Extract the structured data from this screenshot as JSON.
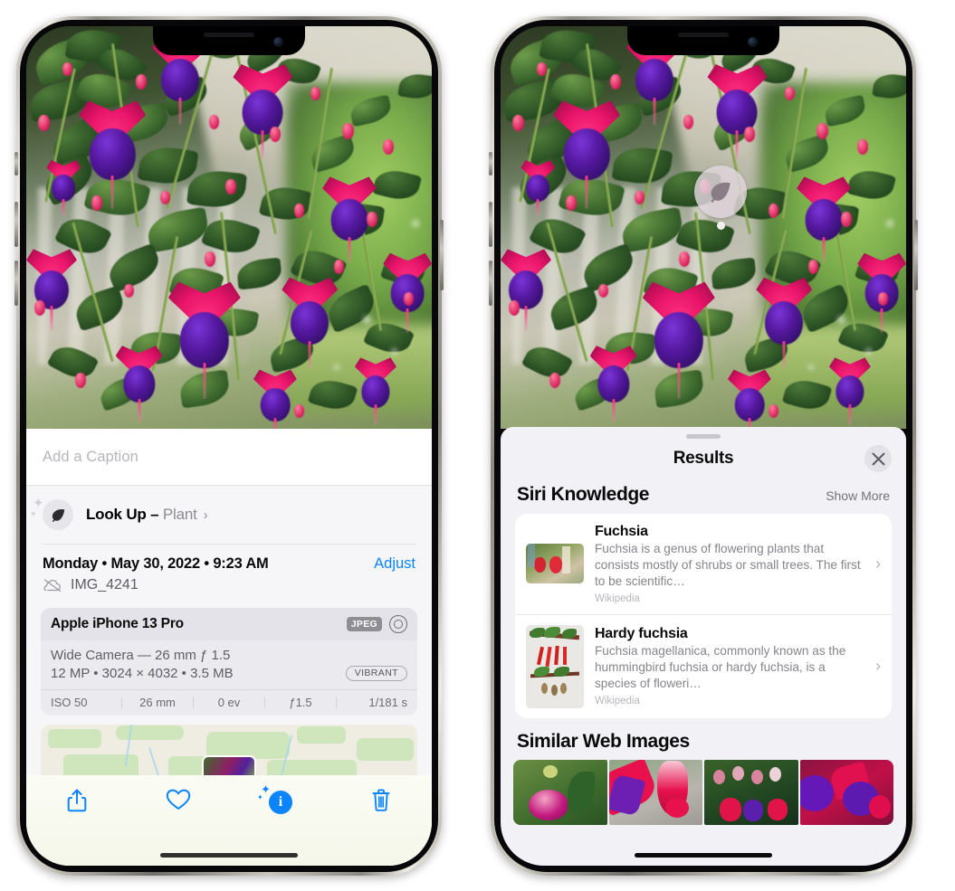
{
  "left_phone": {
    "name": "iphone-photos-info",
    "caption_field": {
      "placeholder": "Add a Caption",
      "value": ""
    },
    "lookup": {
      "icon": "leaf-icon",
      "label": "Look Up – ",
      "subject": "Plant",
      "chevron": "›"
    },
    "metadata": {
      "date_line": "Monday • May 30, 2022 • 9:23 AM",
      "adjust_label": "Adjust",
      "cloud_icon": "cloud-slash-icon",
      "file_name": "IMG_4241"
    },
    "camera_card": {
      "device": "Apple iPhone 13 Pro",
      "format_badge": "JPEG",
      "lens_icon": "lens-icon",
      "lens_line": "Wide Camera — 26 mm ƒ 1.5",
      "specs_line": "12 MP • 3024 × 4032 • 3.5 MB",
      "style_badge": "VIBRANT",
      "exif": [
        "ISO 50",
        "26 mm",
        "0 ev",
        "ƒ1.5",
        "1/181 s"
      ]
    },
    "map": {
      "name": "location-map",
      "pin": "photo-thumbnail-pin"
    },
    "toolbar": [
      {
        "name": "share-button",
        "icon": "share-icon"
      },
      {
        "name": "favorite-button",
        "icon": "heart-icon"
      },
      {
        "name": "visual-lookup-button",
        "icon": "info-sparkle-icon",
        "glyph": "i"
      },
      {
        "name": "delete-button",
        "icon": "trash-icon"
      }
    ]
  },
  "right_phone": {
    "name": "iphone-visual-lookup-results",
    "photo_badge": {
      "icon": "leaf-icon"
    },
    "sheet": {
      "grabber": "drag-handle",
      "title": "Results",
      "close_icon": "close-icon"
    },
    "siri_knowledge": {
      "heading": "Siri Knowledge",
      "show_more": "Show More",
      "items": [
        {
          "thumb": "fuchsia-flowers-thumbnail",
          "title": "Fuchsia",
          "description": "Fuchsia is a genus of flowering plants that consists mostly of shrubs or small trees. The first to be scientific…",
          "source": "Wikipedia",
          "chevron": "›"
        },
        {
          "thumb": "hardy-fuchsia-specimen-thumbnail",
          "title": "Hardy fuchsia",
          "description": "Fuchsia magellanica, commonly known as the hummingbird fuchsia or hardy fuchsia, is a species of floweri…",
          "source": "Wikipedia",
          "chevron": "›"
        }
      ]
    },
    "similar_web_images": {
      "heading": "Similar Web Images",
      "items": [
        "pink-white-fuchsia-thumbnail",
        "red-fuchsia-closeup-thumbnail",
        "fuchsia-bush-thumbnail",
        "purple-red-fuchsia-thumbnail"
      ]
    }
  },
  "colors": {
    "accent_blue": "#0a84ff",
    "sheet_bg": "#f1f1f6",
    "card_bg": "#ffffff",
    "muted_text": "#85858c",
    "badge_gray": "#8e8e93"
  }
}
